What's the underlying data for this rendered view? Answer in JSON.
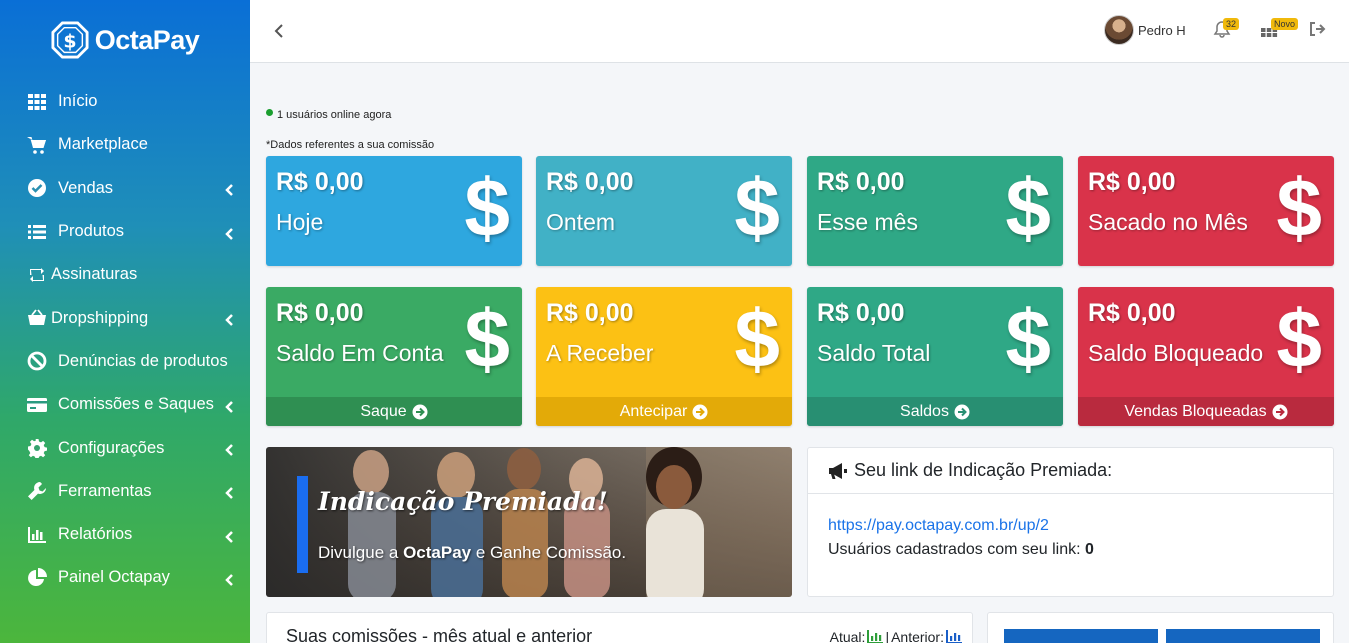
{
  "brand": {
    "name": "OctaPay"
  },
  "sidebar": {
    "items": [
      {
        "label": "Início",
        "icon": "grid-icon",
        "has_submenu": false
      },
      {
        "label": "Marketplace",
        "icon": "cart-icon",
        "has_submenu": false
      },
      {
        "label": "Vendas",
        "icon": "check-circle-icon",
        "has_submenu": true
      },
      {
        "label": "Produtos",
        "icon": "list-icon",
        "has_submenu": true
      },
      {
        "label": "Assinaturas",
        "icon": "retweet-icon",
        "has_submenu": false
      },
      {
        "label": "Dropshipping",
        "icon": "basket-icon",
        "has_submenu": true
      },
      {
        "label": "Denúncias de produtos",
        "icon": "ban-icon",
        "has_submenu": false
      },
      {
        "label": "Comissões e Saques",
        "icon": "credit-card-icon",
        "has_submenu": true
      },
      {
        "label": "Configurações",
        "icon": "gear-icon",
        "has_submenu": true
      },
      {
        "label": "Ferramentas",
        "icon": "wrench-icon",
        "has_submenu": true
      },
      {
        "label": "Relatórios",
        "icon": "bar-chart-icon",
        "has_submenu": true
      },
      {
        "label": "Painel Octapay",
        "icon": "pie-chart-icon",
        "has_submenu": true
      }
    ]
  },
  "topbar": {
    "user_name": "Pedro H",
    "notifications_count": "32",
    "apps_badge": "Novo"
  },
  "status": {
    "online_text": "1 usuários online agora",
    "note": "*Dados referentes a sua comissão"
  },
  "stats": {
    "today": {
      "amount": "R$ 0,00",
      "label": "Hoje",
      "color": "#2ea7df"
    },
    "yesterday": {
      "amount": "R$ 0,00",
      "label": "Ontem",
      "color": "#41b1c6"
    },
    "month": {
      "amount": "R$ 0,00",
      "label": "Esse mês",
      "color": "#2fa886"
    },
    "withdrawn": {
      "amount": "R$ 0,00",
      "label": "Sacado no Mês",
      "color": "#d9334a"
    },
    "balance": {
      "amount": "R$ 0,00",
      "label": "Saldo Em Conta",
      "footer": "Saque",
      "color": "#3aaa64"
    },
    "receivable": {
      "amount": "R$ 0,00",
      "label": "A Receber",
      "footer": "Antecipar",
      "color": "#fcc114"
    },
    "total": {
      "amount": "R$ 0,00",
      "label": "Saldo Total",
      "footer": "Saldos",
      "color": "#2fa886"
    },
    "blocked": {
      "amount": "R$ 0,00",
      "label": "Saldo Bloqueado",
      "footer": "Vendas Bloqueadas",
      "color": "#d9334a"
    }
  },
  "banner": {
    "title": "Indicação Premiada!",
    "sub_prefix": "Divulgue a ",
    "sub_brand": "OctaPay",
    "sub_suffix": " e Ganhe Comissão."
  },
  "referral": {
    "title": "Seu link de Indicação Premiada:",
    "link": "https://pay.octapay.com.br/up/2",
    "users_label": "Usuários cadastrados com seu link:",
    "users_count": "0"
  },
  "commissions_card": {
    "title": "Suas comissões - mês atual e anterior",
    "legend_current": "Atual:",
    "legend_separator": "|",
    "legend_previous": "Anterior:",
    "current_color": "#2e9e3a",
    "previous_color": "#1a5fc8"
  }
}
